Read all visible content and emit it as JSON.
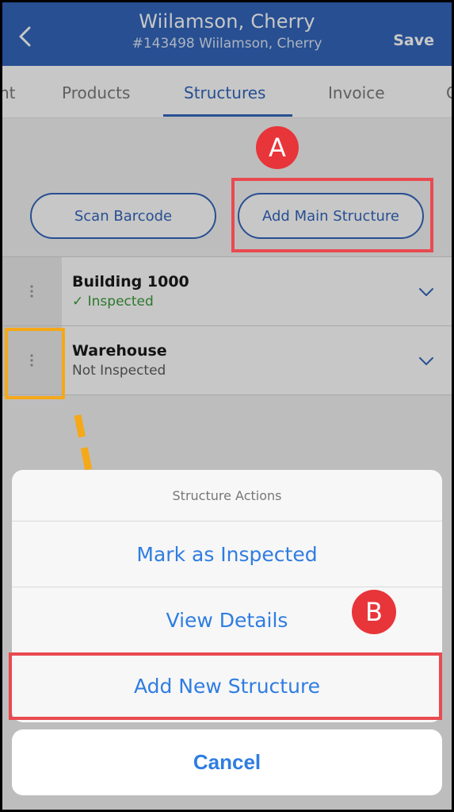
{
  "header": {
    "title": "Wiilamson, Cherry",
    "subtitle": "#143498 Wiilamson, Cherry",
    "save_label": "Save",
    "back_icon": "chevron-left-icon"
  },
  "tabs": [
    {
      "label": "nt"
    },
    {
      "label": "Products"
    },
    {
      "label": "Structures",
      "active": true
    },
    {
      "label": "Invoice"
    },
    {
      "label": "C"
    }
  ],
  "actions": {
    "scan_label": "Scan Barcode",
    "add_main_label": "Add Main Structure"
  },
  "structures": [
    {
      "name": "Building 1000",
      "status": "✓ Inspected",
      "inspected": true
    },
    {
      "name": "Warehouse",
      "status": "Not Inspected",
      "inspected": false
    }
  ],
  "action_sheet": {
    "title": "Structure Actions",
    "items": [
      "Mark as Inspected",
      "View Details",
      "Add New Structure"
    ],
    "cancel_label": "Cancel"
  },
  "annotations": {
    "a_label": "A",
    "b_label": "B"
  },
  "colors": {
    "primary": "#3366bb",
    "ios_blue": "#2f7de1",
    "inspected_green": "#3a9a3a",
    "annotation_red": "#e8353a",
    "annotation_orange": "#f5a818"
  }
}
